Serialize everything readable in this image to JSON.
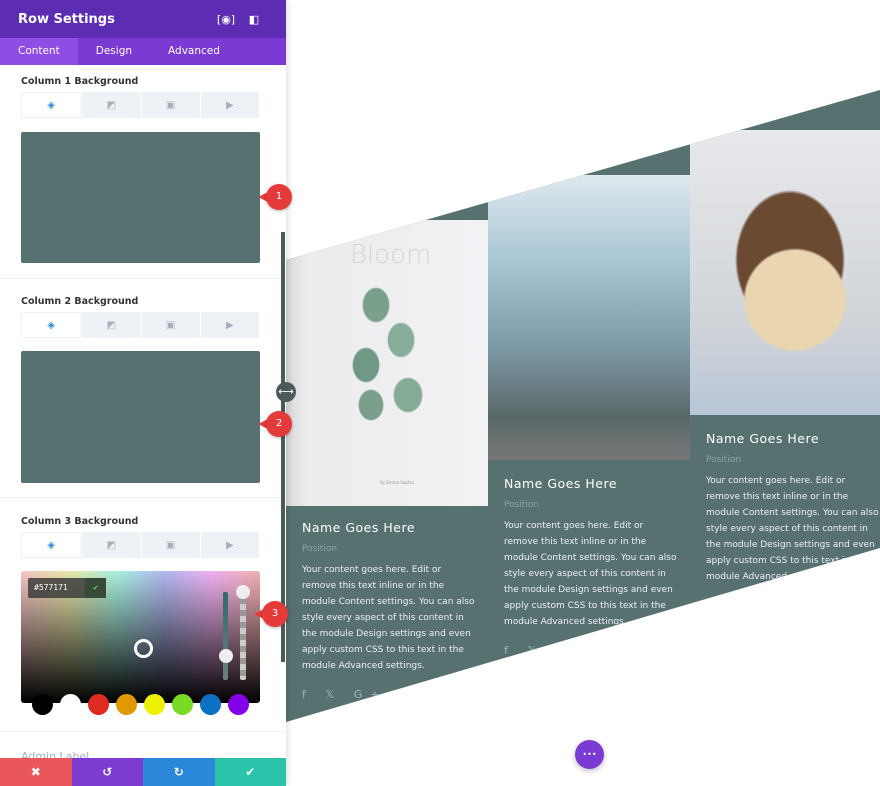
{
  "panel": {
    "title": "Row Settings",
    "header_icons": [
      "fullscreen-icon",
      "sidebar-toggle-icon"
    ],
    "tabs": [
      {
        "label": "Content",
        "active": true
      },
      {
        "label": "Design"
      },
      {
        "label": "Advanced"
      }
    ],
    "sections": [
      {
        "label": "Column 1 Background",
        "color": "#577171"
      },
      {
        "label": "Column 2 Background",
        "color": "#577171"
      },
      {
        "label": "Column 3 Background",
        "color": "#577171"
      }
    ],
    "background_tabs": [
      "color-icon",
      "gradient-icon",
      "image-icon",
      "video-icon"
    ],
    "picker": {
      "hex": "#577171",
      "swatches": [
        "#000000",
        "#ffffff",
        "#e02b20",
        "#e09900",
        "#edf000",
        "#7cda24",
        "#0c71c3",
        "#8300e9"
      ]
    },
    "admin_label": "Admin Label",
    "footer": {
      "cancel": "✖",
      "undo": "↺",
      "redo": "↻",
      "save": "✔"
    }
  },
  "markers": [
    "1",
    "2",
    "3"
  ],
  "canvas": {
    "bloom_title": "Bloom",
    "bloom_caption": "By Emma Sophia",
    "cards": [
      {
        "name": "Name Goes Here",
        "position": "Position",
        "text": "Your content goes here. Edit or remove this text inline or in the module Content settings. You can also style every aspect of this content in the module Design settings and even apply custom CSS to this text in the module Advanced settings."
      },
      {
        "name": "Name Goes Here",
        "position": "Position",
        "text": "Your content goes here. Edit or remove this text inline or in the module Content settings. You can also style every aspect of this content in the module Design settings and even apply custom CSS to this text in the module Advanced settings."
      },
      {
        "name": "Name Goes Here",
        "position": "Position",
        "text": "Your content goes here. Edit or remove this text inline or in the module Content settings. You can also style every aspect of this content in the module Design settings and even apply custom CSS to this text in the module Advanced settings."
      }
    ],
    "social": "f  𝕏  G+  in",
    "more_button": "•••"
  },
  "colors": {
    "header": "#5c2db3",
    "tabs": "#7b3ad3",
    "section_bg": "#577171",
    "cancel": "#e9575a",
    "undo": "#7e3bd0",
    "redo": "#2b87da",
    "save": "#29c4a9"
  }
}
